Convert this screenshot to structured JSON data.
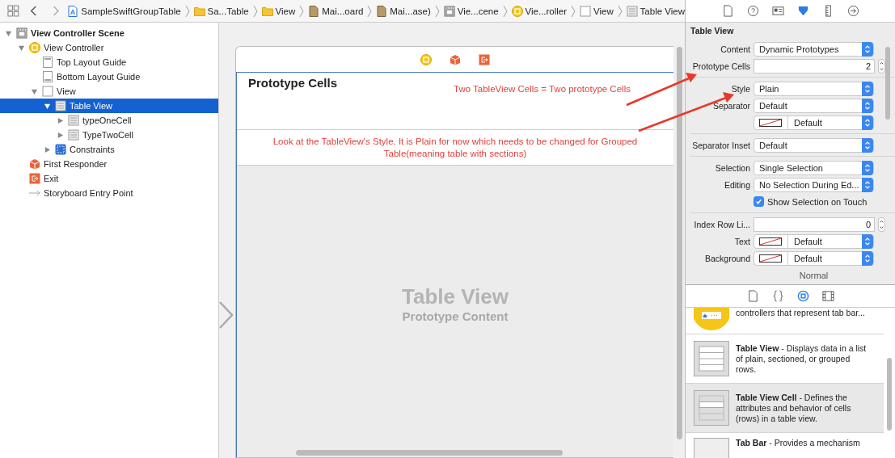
{
  "breadcrumbs": [
    {
      "label": "SampleSwiftGroupTable",
      "kind": "project"
    },
    {
      "label": "Sa...Table",
      "kind": "folder"
    },
    {
      "label": "View",
      "kind": "folder"
    },
    {
      "label": "Mai...oard",
      "kind": "storyboard"
    },
    {
      "label": "Mai...ase)",
      "kind": "storyboard"
    },
    {
      "label": "Vie...cene",
      "kind": "scene"
    },
    {
      "label": "Vie...roller",
      "kind": "controller"
    },
    {
      "label": "View",
      "kind": "view"
    },
    {
      "label": "Table View",
      "kind": "table"
    }
  ],
  "outline": [
    {
      "label": "View Controller Scene",
      "kind": "scene",
      "expanded": true,
      "selected": false,
      "children": [
        {
          "label": "View Controller",
          "kind": "controller",
          "expanded": true,
          "selected": false,
          "children": [
            {
              "label": "Top Layout Guide",
              "kind": "top-guide",
              "selected": false
            },
            {
              "label": "Bottom Layout Guide",
              "kind": "bottom-guide",
              "selected": false
            },
            {
              "label": "View",
              "kind": "view",
              "expanded": true,
              "selected": false,
              "children": [
                {
                  "label": "Table View",
                  "kind": "table",
                  "expanded": true,
                  "selected": true,
                  "children": [
                    {
                      "label": "typeOneCell",
                      "kind": "cell",
                      "expanded": false,
                      "selected": false
                    },
                    {
                      "label": "TypeTwoCell",
                      "kind": "cell",
                      "expanded": false,
                      "selected": false
                    }
                  ]
                },
                {
                  "label": "Constraints",
                  "kind": "constraints",
                  "expanded": false,
                  "selected": false
                }
              ]
            }
          ]
        },
        {
          "label": "First Responder",
          "kind": "responder",
          "selected": false
        },
        {
          "label": "Exit",
          "kind": "exit",
          "selected": false
        },
        {
          "label": "Storyboard Entry Point",
          "kind": "entry",
          "selected": false
        }
      ]
    }
  ],
  "canvas": {
    "header_title": "Prototype Cells",
    "note_cells": "Two TableView  Cells = Two prototype Cells",
    "note_style": "Look at the TableView's Style. It is Plain for now which needs to be changed for Grouped Table(meaning table with sections)",
    "placeholder_title": "Table View",
    "placeholder_subtitle": "Prototype Content"
  },
  "inspector": {
    "section": "Table View",
    "rows": [
      {
        "kind": "popup",
        "label": "Content",
        "value": "Dynamic Prototypes"
      },
      {
        "kind": "stepper",
        "label": "Prototype Cells",
        "value": "2"
      },
      {
        "kind": "divider"
      },
      {
        "kind": "popup",
        "label": "Style",
        "value": "Plain"
      },
      {
        "kind": "popup",
        "label": "Separator",
        "value": "Default"
      },
      {
        "kind": "color",
        "label": "",
        "value": "Default"
      },
      {
        "kind": "divider"
      },
      {
        "kind": "popup",
        "label": "Separator Inset",
        "value": "Default"
      },
      {
        "kind": "divider"
      },
      {
        "kind": "popup",
        "label": "Selection",
        "value": "Single Selection"
      },
      {
        "kind": "popup",
        "label": "Editing",
        "value": "No Selection During Ed..."
      },
      {
        "kind": "checkbox",
        "label": "Show Selection on Touch",
        "checked": true
      },
      {
        "kind": "divider"
      },
      {
        "kind": "stepper",
        "label": "Index Row Li...",
        "value": "0"
      },
      {
        "kind": "color",
        "label": "Text",
        "value": "Default"
      },
      {
        "kind": "color",
        "label": "Background",
        "value": "Default"
      },
      {
        "kind": "caption",
        "label": "Normal"
      }
    ]
  },
  "library": {
    "items": [
      {
        "kind": "tab-controller",
        "text": "controllers that represent tab bar...",
        "selected": false
      },
      {
        "kind": "table",
        "text": "**Table View** - Displays data in a list of plain, sectioned, or grouped rows.",
        "selected": false
      },
      {
        "kind": "cell",
        "text": "**Table View Cell** - Defines the attributes and behavior of cells (rows) in a table view.",
        "selected": true
      },
      {
        "kind": "tab-bar",
        "text": "**Tab Bar** - Provides a mechanism",
        "selected": false
      }
    ]
  }
}
